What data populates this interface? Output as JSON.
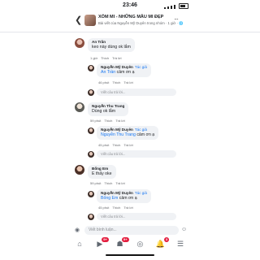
{
  "status_bar": {
    "time": "23:46"
  },
  "header": {
    "group_name": "XÓM MI - NHỮNG MẪU MI ĐẸP",
    "subtitle": "Bài viết của Nguyễn Mỹ Duyên trong nhóm · 1 giờ · 🌐",
    "more": "···"
  },
  "comments": [
    {
      "author": "An Trần",
      "text": "keo này dùng ok lắm",
      "time": "1 giờ",
      "like": "Thích",
      "reply": "Trả lời",
      "response": {
        "author": "Nguyễn Mỹ Duyên",
        "badge": "Tác giả",
        "mention": "An Trần",
        "text": " cảm ơn ạ",
        "time": "46 phút",
        "like": "Thích",
        "reply": "Trả lời"
      },
      "reply_placeholder": "Viết câu trả lời..."
    },
    {
      "author": "Nguyễn Thu Trang",
      "text": "Dùng ok lắm",
      "time": "59 phút",
      "like": "Thích",
      "reply": "Trả lời",
      "response": {
        "author": "Nguyễn Mỹ Duyên",
        "badge": "Tác giả",
        "mention": "Nguyễn Thu Trang",
        "text": " cảm ơn ạ",
        "time": "45 phút",
        "like": "Thích",
        "reply": "Trả lời"
      },
      "reply_placeholder": "Viết câu trả lời..."
    },
    {
      "author": "Bống Em",
      "text": "E thấy oke",
      "time": "59 phút",
      "like": "Thích",
      "reply": "Trả lời",
      "response": {
        "author": "Nguyễn Mỹ Duyên",
        "badge": "Tác giả",
        "mention": "Bống Em",
        "text": " cảm ơn ạ",
        "time": "45 phút",
        "like": "Thích",
        "reply": "Trả lời"
      },
      "reply_placeholder": "Viết câu trả lời..."
    }
  ],
  "input": {
    "placeholder": "Viết bình luận..."
  },
  "tabs": {
    "video_badge": "9+",
    "groups_badge": "9+",
    "notifications_badge": "3"
  },
  "colors": {
    "accent": "#1877f2",
    "badge": "#e41e3f",
    "bubble": "#f0f2f5"
  }
}
